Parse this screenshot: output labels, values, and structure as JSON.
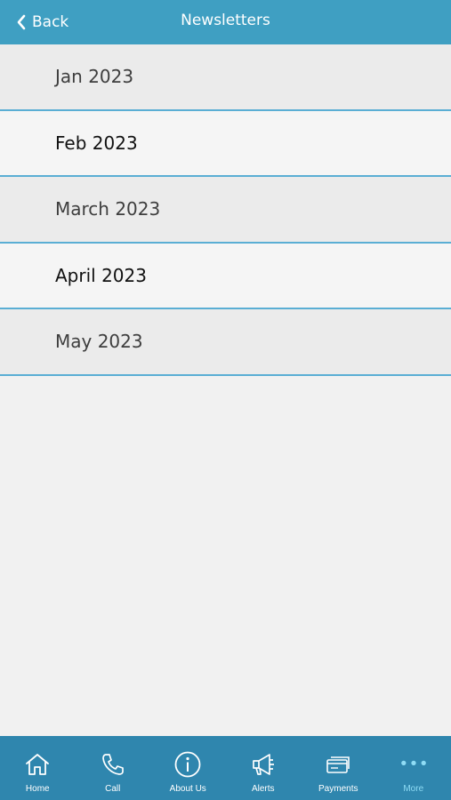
{
  "header": {
    "back_label": "Back",
    "title": "Newsletters",
    "background": "#3f9fc2"
  },
  "newsletters": [
    {
      "label": "Jan 2023"
    },
    {
      "label": "Feb 2023"
    },
    {
      "label": "March 2023"
    },
    {
      "label": "April 2023"
    },
    {
      "label": "May 2023"
    }
  ],
  "tabbar": {
    "background": "#2f86ae",
    "active_color": "#8fdcf5",
    "items": [
      {
        "label": "Home",
        "icon": "home-icon"
      },
      {
        "label": "Call",
        "icon": "phone-icon"
      },
      {
        "label": "About Us",
        "icon": "info-icon"
      },
      {
        "label": "Alerts",
        "icon": "megaphone-icon"
      },
      {
        "label": "Payments",
        "icon": "payment-card-icon"
      },
      {
        "label": "More",
        "icon": "more-dots-icon",
        "active": true
      }
    ]
  }
}
